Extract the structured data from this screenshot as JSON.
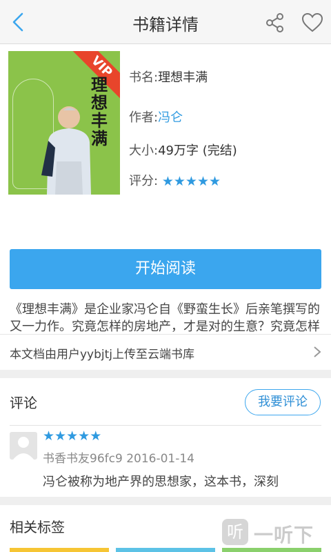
{
  "header": {
    "title": "书籍详情",
    "back_icon": "back-arrow-icon",
    "share_icon": "share-icon",
    "favorite_icon": "heart-icon"
  },
  "book": {
    "cover": {
      "badge": "VIP",
      "title_vertical": "理想丰满",
      "bg_color": "#8bc34a",
      "badge_color": "#e8452b"
    },
    "name_label": "书名:",
    "name_value": "理想丰满",
    "author_label": "作者:",
    "author_value": "冯仑",
    "size_label": "大小:",
    "size_value": "49万字 (完结)",
    "rating_label": "评分:",
    "rating_stars": 5,
    "read_button": "开始阅读",
    "description": "《理想丰满》是企业家冯仑自《野蛮生长》后亲笔撰写的又一力作。究竟怎样的房地产，才是对的生意？究竟怎样的社会，才会给力民营企业？究竟怎样的人生，才能创造生命",
    "description_more": "...",
    "uploader_text": "本文档由用户yybjtj上传至云端书库"
  },
  "comments": {
    "heading": "评论",
    "write_button": "我要评论",
    "items": [
      {
        "stars": 5,
        "user": "书香书友96fc9",
        "date": "2016-01-14",
        "text": "冯仑被称为地产界的思想家，这本书，深刻"
      }
    ]
  },
  "tags": {
    "heading": "相关标签"
  },
  "watermark": {
    "icon_glyph": "听",
    "text": "一听下载"
  },
  "colors": {
    "accent": "#3ba6ee",
    "link": "#2f9ae0"
  }
}
